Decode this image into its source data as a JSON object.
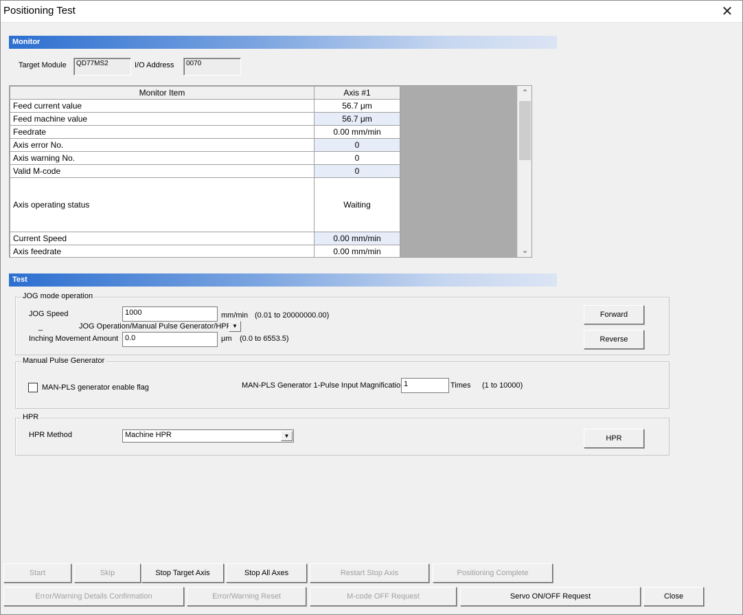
{
  "window": {
    "title": "Positioning Test"
  },
  "monitor": {
    "section_title": "Monitor",
    "target_module_label": "Target Module",
    "target_module_value": "QD77MS2",
    "io_address_label": "I/O Address",
    "io_address_value": "0070",
    "columns": [
      "Monitor Item",
      "Axis #1"
    ],
    "rows": [
      {
        "item": "Feed current value",
        "value": "56.7 μm"
      },
      {
        "item": "Feed machine value",
        "value": "56.7 μm"
      },
      {
        "item": "Feedrate",
        "value": "0.00 mm/min"
      },
      {
        "item": "Axis error No.",
        "value": "0"
      },
      {
        "item": "Axis warning No.",
        "value": "0"
      },
      {
        "item": "Valid M-code",
        "value": "0"
      },
      {
        "item": "Axis operating status",
        "value": "Waiting"
      },
      {
        "item": "Current Speed",
        "value": "0.00 mm/min"
      },
      {
        "item": "Axis feedrate",
        "value": "0.00 mm/min"
      }
    ]
  },
  "test": {
    "section_title": "Test",
    "jog": {
      "group_title": "JOG mode operation",
      "speed_label": "JOG Speed",
      "speed_value": "1000",
      "speed_unit": "mm/min",
      "speed_range": "(0.01 to 20000000.00)",
      "mode_label": "JOG Operation/Manual Pulse Generator/HPR",
      "inching_label": "Inching Movement Amount",
      "inching_value": "0.0",
      "inching_unit": "μm",
      "inching_range": "(0.0 to 6553.5)",
      "forward_label": "Forward",
      "reverse_label": "Reverse"
    },
    "mpg": {
      "group_title": "Manual Pulse Generator",
      "enable_label": "MAN-PLS generator enable flag",
      "magnification_label": "MAN-PLS Generator 1-Pulse Input Magnification",
      "magnification_value": "1",
      "magnification_unit": "Times",
      "magnification_range": "(1 to 10000)"
    },
    "hpr": {
      "group_title": "HPR",
      "method_label": "HPR Method",
      "method_value": "Machine HPR",
      "hpr_button": "HPR"
    }
  },
  "buttons": {
    "start": "Start",
    "skip": "Skip",
    "stop_target_axis": "Stop Target Axis",
    "stop_all_axes": "Stop All Axes",
    "restart_stop_axis": "Restart Stop Axis",
    "positioning_complete": "Positioning Complete",
    "error_details": "Error/Warning Details Confirmation",
    "error_reset": "Error/Warning Reset",
    "mcode_off": "M-code OFF Request",
    "servo_onoff": "Servo ON/OFF Request",
    "close": "Close"
  }
}
